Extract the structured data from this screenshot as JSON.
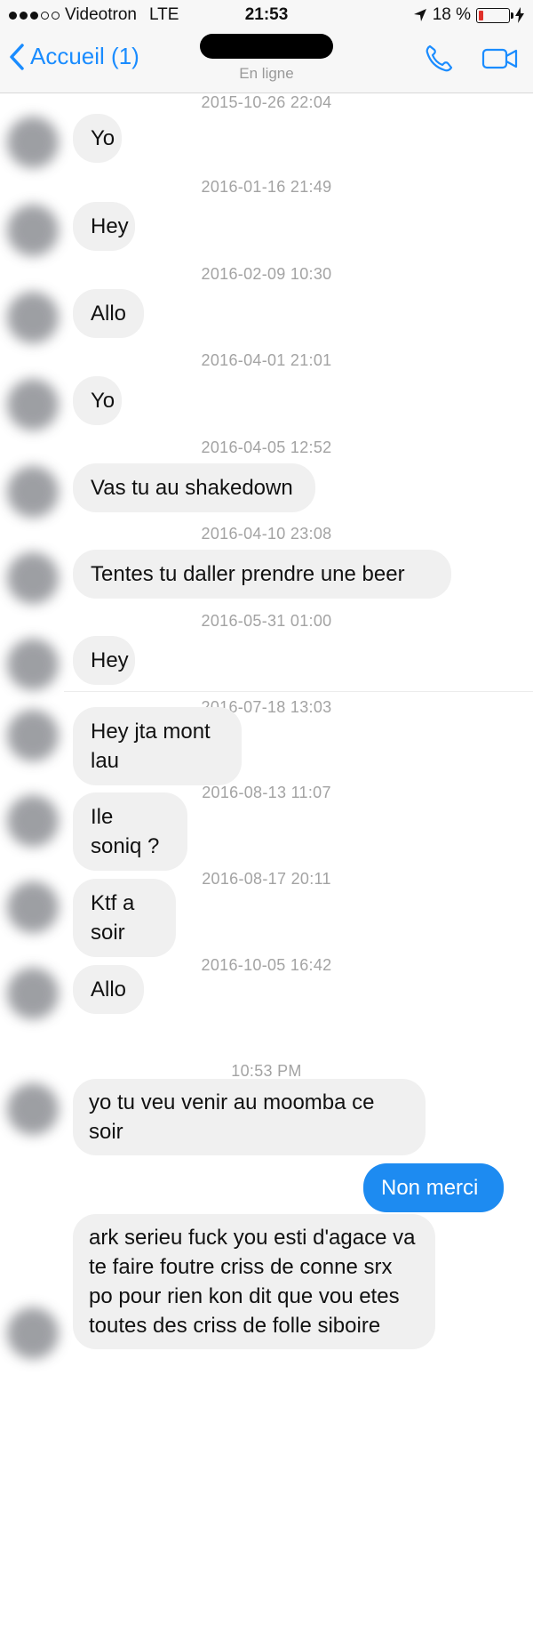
{
  "status_bar": {
    "carrier": "Videotron",
    "network": "LTE",
    "time": "21:53",
    "battery_percent": "18 %",
    "battery_level": 0.18
  },
  "header": {
    "back_label": "Accueil (1)",
    "contact_status": "En ligne"
  },
  "colors": {
    "accent": "#1a8cff",
    "outgoing_bubble": "#1d8bf1",
    "incoming_bubble": "#f0f0f0"
  },
  "messages": [
    {
      "timestamp": "2015-10-26 22:04",
      "text": "Yo"
    },
    {
      "timestamp": "2016-01-16 21:49",
      "text": "Hey"
    },
    {
      "timestamp": "2016-02-09 10:30",
      "text": "Allo"
    },
    {
      "timestamp": "2016-04-01 21:01",
      "text": "Yo"
    },
    {
      "timestamp": "2016-04-05 12:52",
      "text": "Vas tu au shakedown"
    },
    {
      "timestamp": "2016-04-10 23:08",
      "text": "Tentes tu daller prendre une beer"
    },
    {
      "timestamp": "2016-05-31 01:00",
      "text": "Hey"
    },
    {
      "timestamp": "2016-07-18 13:03",
      "text": "Hey jta mont lau"
    },
    {
      "timestamp": "2016-08-13 11:07",
      "text": "Ile soniq ?"
    },
    {
      "timestamp": "2016-08-17 20:11",
      "text": "Ktf a soir"
    },
    {
      "timestamp": "2016-10-05 16:42",
      "text": "Allo"
    },
    {
      "timestamp": "10:53 PM",
      "text": "yo tu veu venir au moomba ce soir"
    }
  ],
  "outgoing_message": "Non merci",
  "last_message": "ark serieu fuck you esti d'agace va te faire foutre criss de conne srx po pour rien kon dit que vou etes toutes des criss de folle siboire"
}
